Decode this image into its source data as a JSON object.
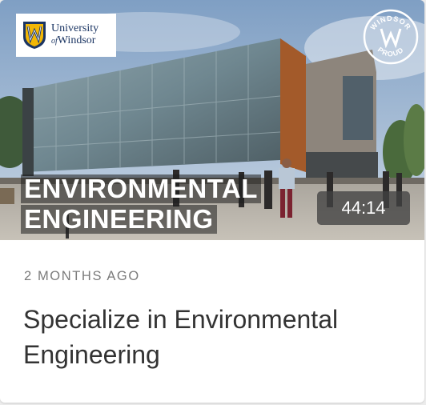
{
  "logo": {
    "line1": "University",
    "line2_prefix": "of",
    "line2": "Windsor"
  },
  "badge": {
    "top_text": "WINDSOR",
    "bottom_text": "PROUD"
  },
  "thumbnail": {
    "title_line1": "ENVIRONMENTAL",
    "title_line2": "ENGINEERING"
  },
  "duration": "44:14",
  "meta": {
    "posted": "2 MONTHS AGO"
  },
  "title": "Specialize in Environmental Engineering",
  "colors": {
    "title_text": "#333333",
    "meta_text": "#7b7b7b",
    "logo_blue": "#1b3563",
    "logo_gold": "#f2b705"
  }
}
